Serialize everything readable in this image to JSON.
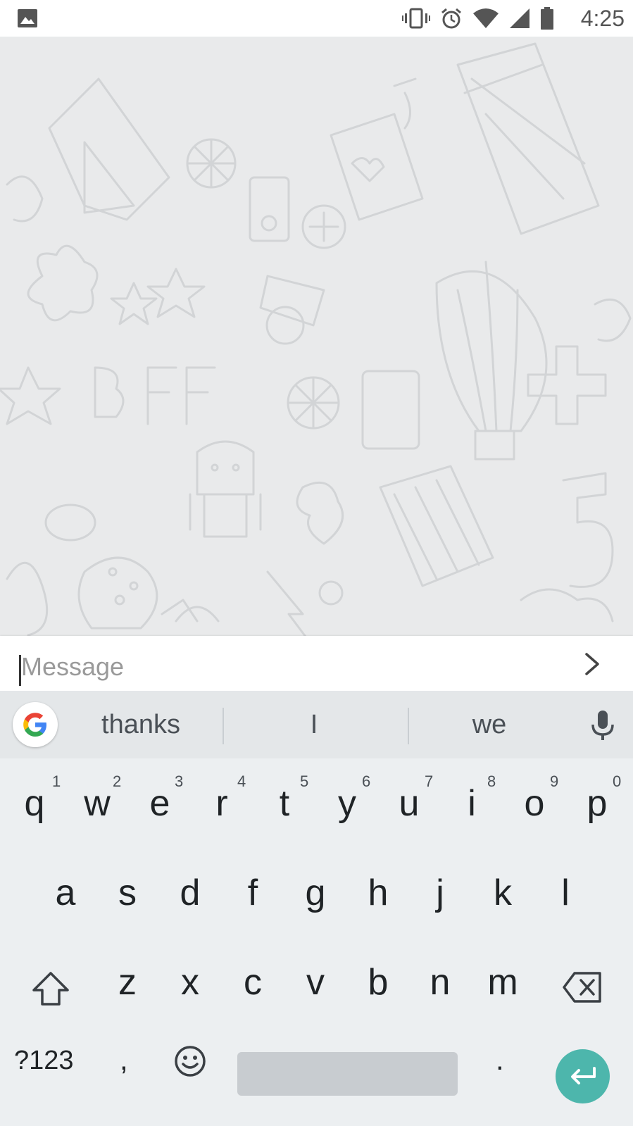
{
  "status_bar": {
    "time": "4:25",
    "icons": [
      "gallery-icon",
      "vibrate-icon",
      "alarm-icon",
      "wifi-icon",
      "cell-signal-icon",
      "battery-icon"
    ]
  },
  "composer": {
    "placeholder": "Message",
    "value": ""
  },
  "keyboard": {
    "suggestions": [
      "thanks",
      "I",
      "we"
    ],
    "row1": [
      {
        "key": "q",
        "hint": "1"
      },
      {
        "key": "w",
        "hint": "2"
      },
      {
        "key": "e",
        "hint": "3"
      },
      {
        "key": "r",
        "hint": "4"
      },
      {
        "key": "t",
        "hint": "5"
      },
      {
        "key": "y",
        "hint": "6"
      },
      {
        "key": "u",
        "hint": "7"
      },
      {
        "key": "i",
        "hint": "8"
      },
      {
        "key": "o",
        "hint": "9"
      },
      {
        "key": "p",
        "hint": "0"
      }
    ],
    "row2": [
      "a",
      "s",
      "d",
      "f",
      "g",
      "h",
      "j",
      "k",
      "l"
    ],
    "row3": [
      "z",
      "x",
      "c",
      "v",
      "b",
      "n",
      "m"
    ],
    "symbols_label": "?123",
    "comma": ",",
    "period": ".",
    "accent_color": "#4db6ac"
  }
}
